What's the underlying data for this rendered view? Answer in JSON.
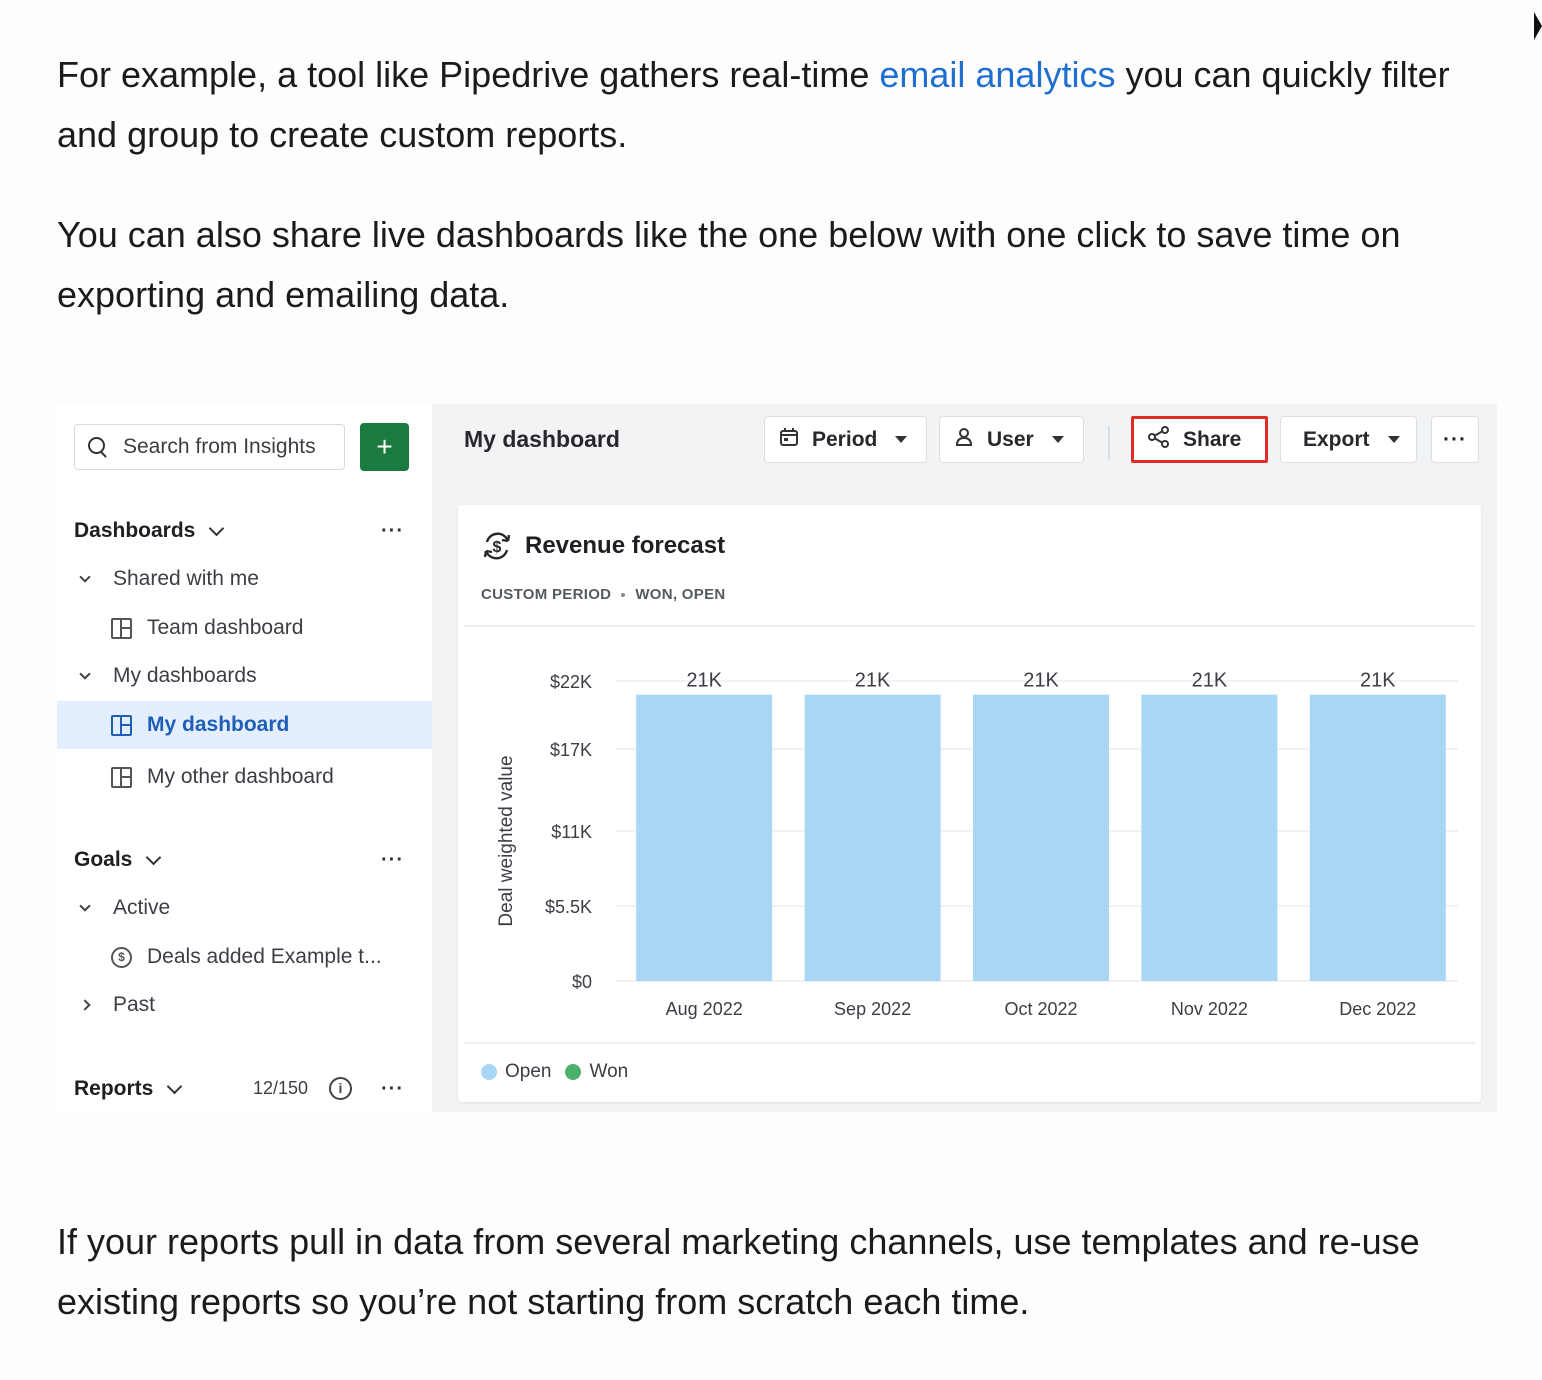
{
  "article": {
    "p1_before": "For example, a tool like Pipedrive gathers real-time ",
    "p1_link": "email analytics",
    "p1_after": " you can quickly filter and group to create custom reports.",
    "p2": "You can also share live dashboards like the one below with one click to save time on exporting and emailing data.",
    "p3": "If your reports pull in data from several marketing channels, use templates and re-use existing reports so you’re not starting from scratch each time."
  },
  "sidebar": {
    "search_placeholder": "Search from Insights",
    "add_label": "+",
    "dashboards_heading": "Dashboards",
    "shared_with_me": "Shared with me",
    "team_dashboard": "Team dashboard",
    "my_dashboards": "My dashboards",
    "my_dashboard": "My dashboard",
    "my_other_dashboard": "My other dashboard",
    "goals_heading": "Goals",
    "active": "Active",
    "goal_item": "Deals added Example t...",
    "past": "Past",
    "reports_heading": "Reports",
    "reports_count": "12/150",
    "more": "···"
  },
  "toolbar": {
    "title": "My dashboard",
    "period": "Period",
    "user": "User",
    "share": "Share",
    "export": "Export",
    "more": "···"
  },
  "card": {
    "title": "Revenue forecast",
    "sub_left": "CUSTOM PERIOD",
    "sub_right": "WON, OPEN"
  },
  "legend": [
    {
      "name": "Open",
      "color": "#a9d6f5"
    },
    {
      "name": "Won",
      "color": "#4caf6a"
    }
  ],
  "colors": {
    "bar": "#a9d6f5",
    "accent": "#1f6fd1",
    "share_outline": "#e12b26",
    "add_button": "#1b7a3e"
  },
  "chart_data": {
    "type": "bar",
    "ylabel": "Deal weighted value",
    "categories": [
      "Aug 2022",
      "Sep 2022",
      "Oct 2022",
      "Nov 2022",
      "Dec 2022"
    ],
    "series": [
      {
        "name": "Open",
        "values": [
          21000,
          21000,
          21000,
          21000,
          21000
        ]
      }
    ],
    "data_labels": [
      "21K",
      "21K",
      "21K",
      "21K",
      "21K"
    ],
    "yticks": [
      0,
      5500,
      11000,
      17000,
      22000
    ],
    "ytick_labels": [
      "$0",
      "$5.5K",
      "$11K",
      "$17K",
      "$22K"
    ],
    "ylim": [
      0,
      22000
    ],
    "grid": true
  }
}
